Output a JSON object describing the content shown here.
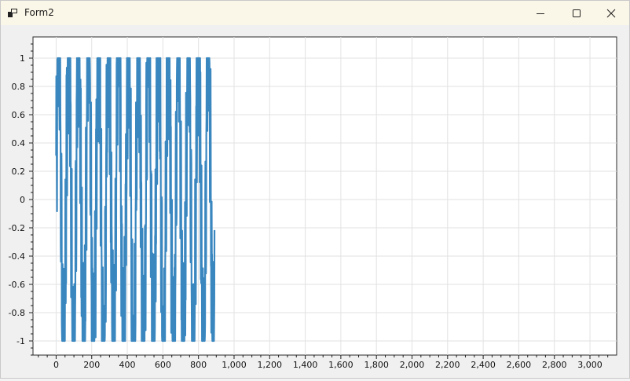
{
  "window": {
    "title": "Form2"
  },
  "controls": {
    "minimize_icon": "minimize-icon",
    "maximize_icon": "maximize-icon",
    "close_icon": "close-icon"
  },
  "colors": {
    "series": "#3a87c0",
    "grid": "#e2e2e2",
    "axis": "#1f1f1f"
  },
  "chart_data": {
    "type": "line",
    "x_ticks": [
      "0",
      "200",
      "400",
      "600",
      "800",
      "1,000",
      "1,200",
      "1,400",
      "1,600",
      "1,800",
      "2,000",
      "2,200",
      "2,400",
      "2,600",
      "2,800",
      "3,000"
    ],
    "y_ticks": [
      "1",
      "0.8",
      "0.6",
      "0.4",
      "0.2",
      "0",
      "-0.2",
      "-0.4",
      "-0.6",
      "-0.8",
      "-1"
    ],
    "xlim": [
      -130,
      3150
    ],
    "ylim": [
      -1.1,
      1.15
    ],
    "grid": true,
    "legend": "none",
    "series": [
      {
        "x_range": [
          0,
          890
        ],
        "y_range": [
          -1,
          1
        ],
        "points": 890,
        "style": "dense oscillation"
      }
    ]
  }
}
